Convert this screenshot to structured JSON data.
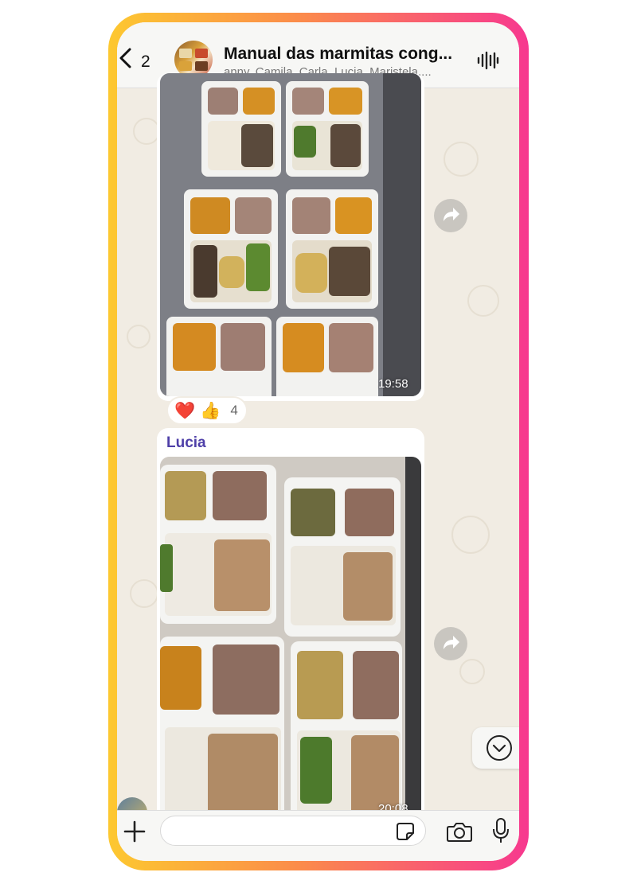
{
  "header": {
    "unread_count": "2",
    "group_title": "Manual das marmitas cong...",
    "group_members": "anny, Camila, Carla, Lucia, Maristela,..."
  },
  "messages": [
    {
      "type": "photo",
      "time": "19:58",
      "reactions": [
        {
          "emoji": "❤️"
        },
        {
          "emoji": "👍"
        }
      ],
      "reaction_count": "4"
    },
    {
      "type": "photo",
      "sender": "Lucia",
      "time": "20:08"
    }
  ],
  "composer": {
    "placeholder": ""
  },
  "colors": {
    "sender_name": "#4e3fa8",
    "frame_start": "#fdc830",
    "frame_end": "#f7388f"
  },
  "icons": [
    "back-icon",
    "waveform-icon",
    "forward-icon",
    "chevron-down-icon",
    "plus-icon",
    "sticker-icon",
    "camera-icon",
    "mic-icon"
  ]
}
